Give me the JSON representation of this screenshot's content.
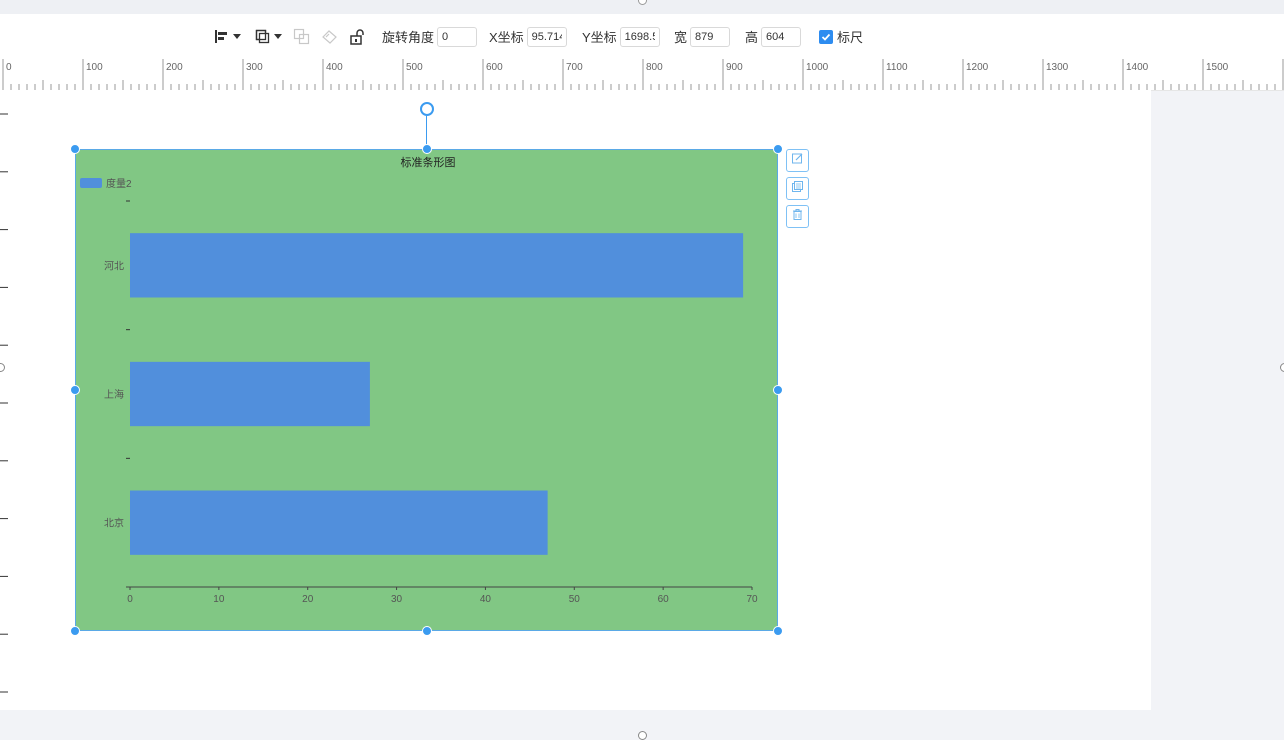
{
  "toolbar": {
    "align_icon": "align-left-icon",
    "layer_icon": "layer-icon",
    "group_icon": "group-icon",
    "ungroup_icon": "ungroup-icon",
    "lock_icon": "unlock-icon",
    "rotate_label": "旋转角度",
    "rotate_value": "0",
    "x_label": "X坐标",
    "x_value": "95.714",
    "y_label": "Y坐标",
    "y_value": "1698.5",
    "w_label": "宽",
    "w_value": "879",
    "h_label": "高",
    "h_value": "604",
    "ruler_label": "标尺",
    "ruler_checked": true
  },
  "ruler": {
    "labels": [
      "0",
      "100",
      "200",
      "300",
      "400",
      "500",
      "600",
      "700",
      "800",
      "900",
      "1000",
      "1100",
      "1200",
      "1300",
      "1400",
      "1500"
    ]
  },
  "side_actions": {
    "edit_icon": "edit-icon",
    "copy_icon": "copy-icon",
    "delete_icon": "delete-icon"
  },
  "colors": {
    "chart_bg": "#81c784",
    "bar": "#518fdc",
    "selection": "#3b9bf0"
  },
  "chart_data": {
    "type": "bar",
    "orientation": "horizontal",
    "title": "标准条形图",
    "categories": [
      "河北",
      "上海",
      "北京"
    ],
    "series": [
      {
        "name": "度量2",
        "values": [
          69,
          27,
          47
        ]
      }
    ],
    "xlim": [
      0,
      70
    ],
    "xticks": [
      "0",
      "10",
      "20",
      "30",
      "40",
      "50",
      "60",
      "70"
    ],
    "legend_position": "top-left",
    "grid": false
  }
}
